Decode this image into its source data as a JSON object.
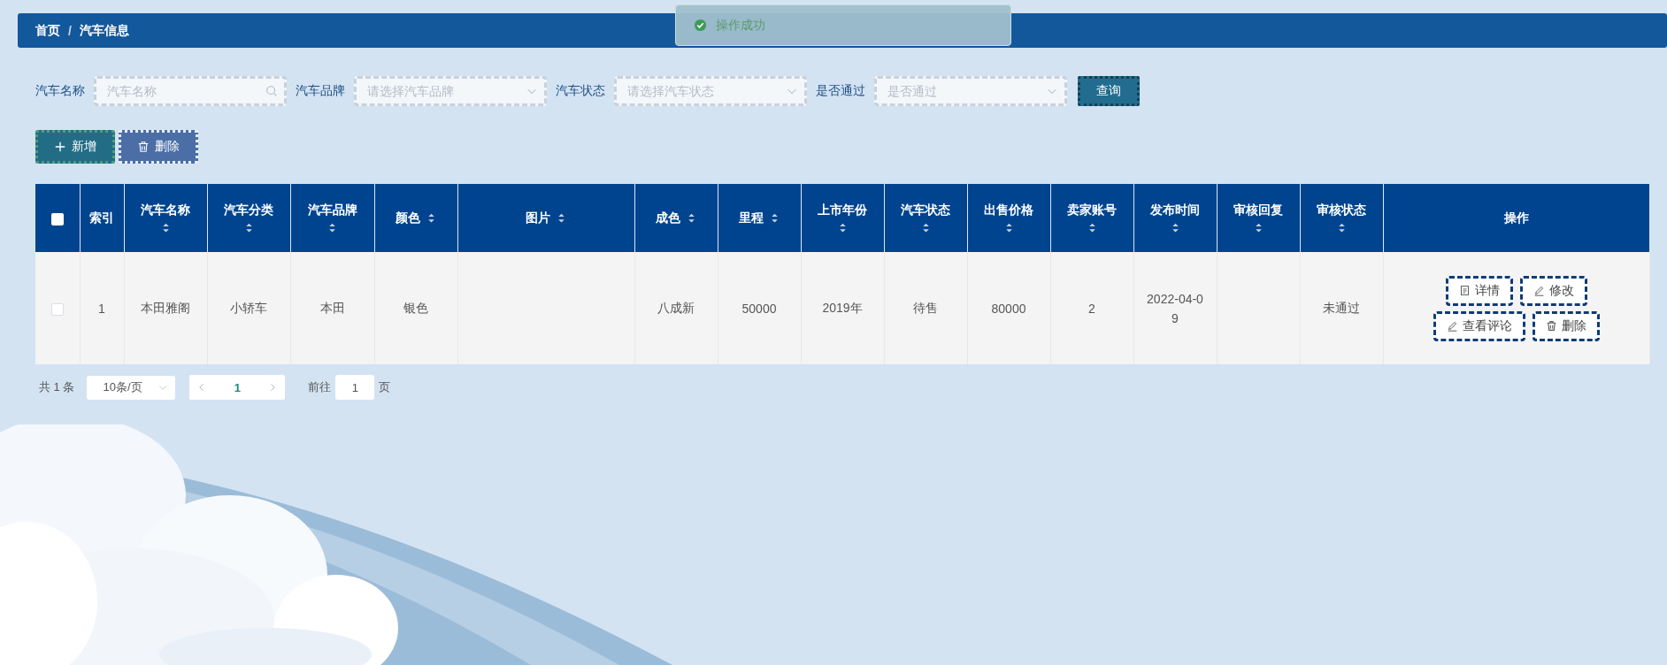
{
  "breadcrumb": [
    {
      "label": "首页"
    },
    {
      "label": "汽车信息"
    }
  ],
  "breadcrumb_separator": "/",
  "toast": {
    "message": "操作成功"
  },
  "filters": [
    {
      "label": "汽车名称",
      "placeholder": "汽车名称",
      "kind": "text"
    },
    {
      "label": "汽车品牌",
      "placeholder": "请选择汽车品牌",
      "kind": "select"
    },
    {
      "label": "汽车状态",
      "placeholder": "请选择汽车状态",
      "kind": "select"
    },
    {
      "label": "是否通过",
      "placeholder": "是否通过",
      "kind": "select"
    }
  ],
  "query_button": "查询",
  "actions": [
    {
      "label": "新增",
      "kind": "add"
    },
    {
      "label": "删除",
      "kind": "delete"
    }
  ],
  "table": {
    "select_all_checked": false,
    "columns": [
      {
        "label": "索引",
        "sortable": false
      },
      {
        "label": "汽车名称",
        "sortable": true
      },
      {
        "label": "汽车分类",
        "sortable": true
      },
      {
        "label": "汽车品牌",
        "sortable": true
      },
      {
        "label": "颜色",
        "sortable": true
      },
      {
        "label": "图片",
        "sortable": true
      },
      {
        "label": "成色",
        "sortable": true
      },
      {
        "label": "里程",
        "sortable": true
      },
      {
        "label": "上市年份",
        "sortable": true
      },
      {
        "label": "汽车状态",
        "sortable": true
      },
      {
        "label": "出售价格",
        "sortable": true
      },
      {
        "label": "卖家账号",
        "sortable": true
      },
      {
        "label": "发布时间",
        "sortable": true
      },
      {
        "label": "审核回复",
        "sortable": true
      },
      {
        "label": "审核状态",
        "sortable": true
      },
      {
        "label": "操作",
        "sortable": false
      }
    ],
    "rows": [
      {
        "checked": false,
        "cells": [
          "1",
          "本田雅阁",
          "小轿车",
          "本田",
          "银色",
          null,
          "八成新",
          "50000",
          "2019年",
          "待售",
          "80000",
          "2",
          "2022-04-09",
          null,
          "未通过"
        ],
        "buttons": [
          {
            "label": "详情",
            "kind": "document"
          },
          {
            "label": "修改",
            "kind": "pencil"
          },
          {
            "label": "查看评论",
            "kind": "pencil"
          },
          {
            "label": "删除",
            "kind": "trash"
          }
        ]
      }
    ]
  },
  "pagination": {
    "total": "共 1 条",
    "page_size": "10条/页",
    "pages": [
      {
        "label": "1",
        "selected": true
      }
    ],
    "goto_label": "前往",
    "goto_value": "1",
    "goto_suffix": "页"
  }
}
